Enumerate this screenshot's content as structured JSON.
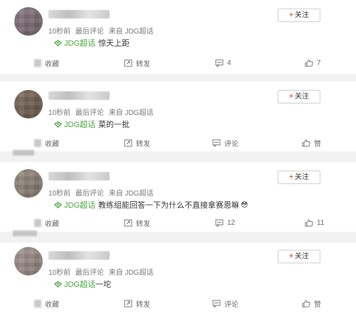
{
  "follow_label": "关注",
  "follow_plus": "+",
  "posts": [
    {
      "time": "10秒前",
      "last_reply": "最后评论",
      "source": "来自 JDG超话",
      "topic": "JDG超话",
      "text": "惊天上距",
      "actions": {
        "favorite": "收藏",
        "share": "转发",
        "comment": "4",
        "like": "7"
      }
    },
    {
      "time": "10秒前",
      "last_reply": "最后评论",
      "source": "来自 JDG超话",
      "topic": "JDG超话",
      "text": "菜的一批",
      "actions": {
        "favorite": "收藏",
        "share": "转发",
        "comment": "评论",
        "like": "赞"
      }
    },
    {
      "time": "10秒前",
      "last_reply": "最后评论",
      "source": "来自 JDG超话",
      "topic": "JDG超话",
      "text": "教练组能回答一下为什么不直接拿赛恩嘛",
      "emoji": "😳",
      "actions": {
        "favorite": "收藏",
        "share": "转发",
        "comment": "12",
        "like": "11"
      }
    },
    {
      "time": "10秒前",
      "last_reply": "最后评论",
      "source": "来自 JDG超话",
      "topic": "JDG超话",
      "text": "一坨",
      "actions": {
        "favorite": "收藏",
        "share": "转发",
        "comment": "评论",
        "like": "赞"
      }
    }
  ],
  "colors": {
    "topic_green": "#47a43c",
    "follow_plus": "#f45a2c",
    "avatar_tones": [
      "#7a6a72",
      "#6f5a4c",
      "#8a7f72",
      "#9a8a86"
    ]
  }
}
